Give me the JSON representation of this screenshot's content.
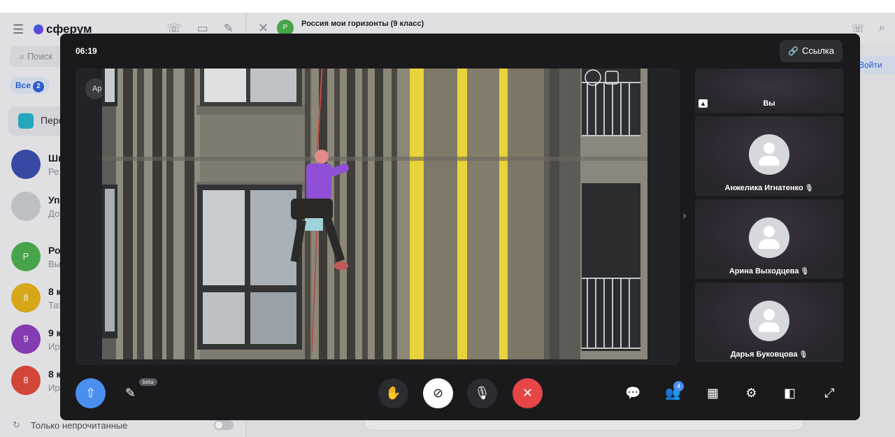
{
  "app": {
    "logo_text": "сферум",
    "search_placeholder": "Поиск",
    "filter_label": "Все",
    "filter_count": "2",
    "pinned_label": "Перс",
    "only_unread_label": "Только непрочитанные",
    "chats": [
      {
        "name": "Шк",
        "sub": "Ре",
        "color": "#3b4fae",
        "initial": ""
      },
      {
        "name": "Упр",
        "sub": "До",
        "color": "#c9ccd2",
        "initial": ""
      },
      {
        "name": "Рос",
        "sub": "Вы",
        "color": "#4caf50",
        "initial": "Р"
      },
      {
        "name": "8 к",
        "sub": "Тат",
        "color": "#e3b21b",
        "initial": "8"
      },
      {
        "name": "9 к",
        "sub": "Ир",
        "color": "#8e3fbd",
        "initial": "9"
      },
      {
        "name": "8 к",
        "sub": "Ир",
        "color": "#e04b3c",
        "initial": "8"
      }
    ]
  },
  "chat_header": {
    "avatar_initial": "Р",
    "title": "Россия мои горизонты (9 класс)",
    "login_label": "Войти"
  },
  "call": {
    "timer": "06:19",
    "link_label": "Ссылка",
    "stage_chip": "Ар",
    "tiles": [
      {
        "name": "Вы",
        "self": true,
        "muted": false
      },
      {
        "name": "Анжелика Игнатенко",
        "self": false,
        "muted": true
      },
      {
        "name": "Арина Выходцева",
        "self": false,
        "muted": true
      },
      {
        "name": "Дарья Буковцова",
        "self": false,
        "muted": true
      }
    ],
    "beta_label": "beta",
    "participants_count": "4"
  },
  "colors": {
    "call_bg": "#1a1a1c",
    "accent_blue": "#4a8ff0",
    "end_call_red": "#e64646",
    "building_yellow": "#e8d33a"
  }
}
